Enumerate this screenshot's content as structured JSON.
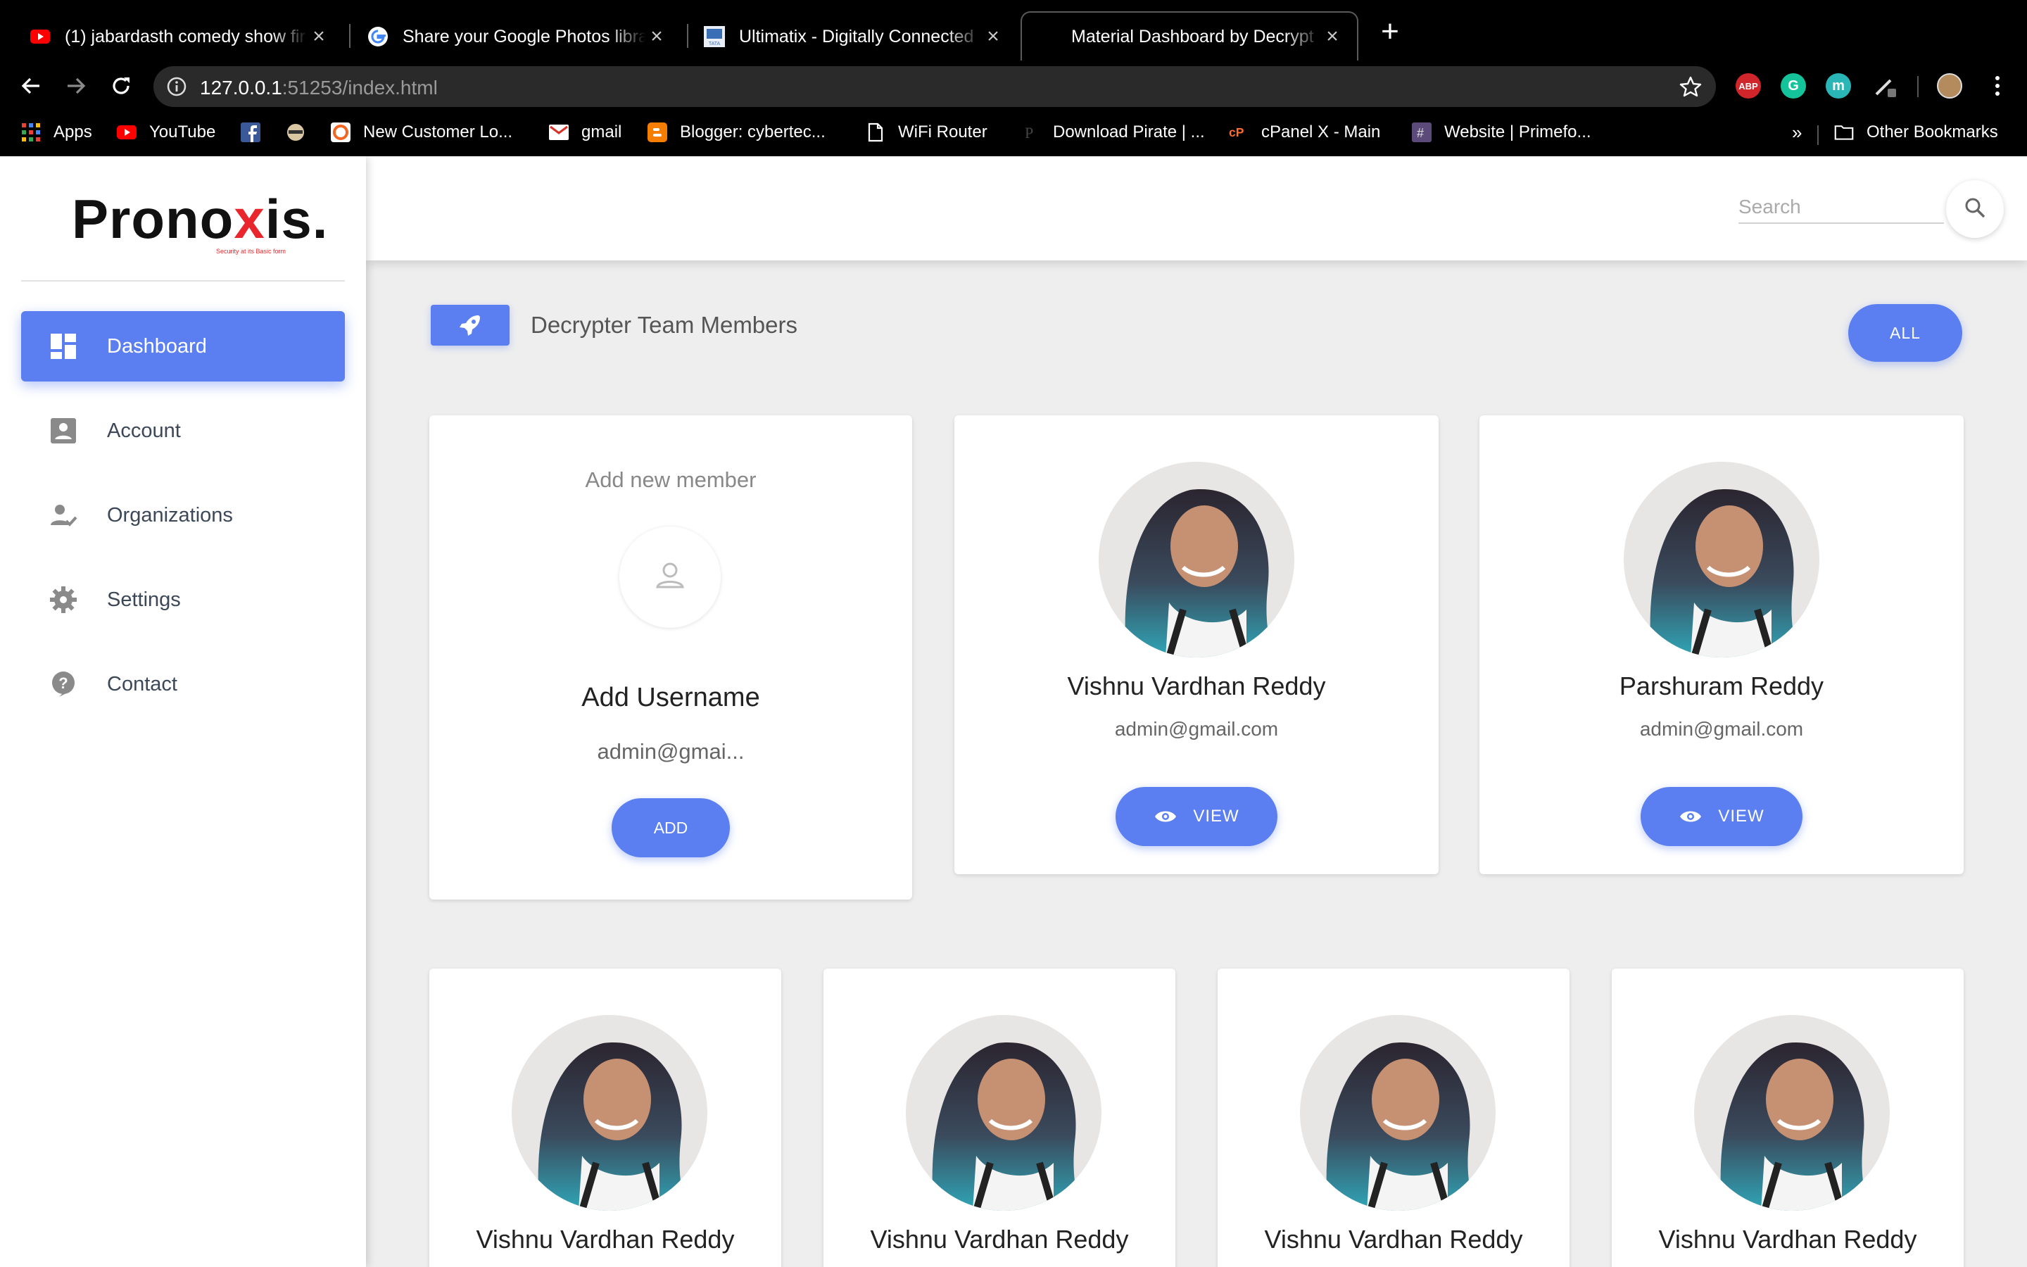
{
  "browser": {
    "tabs": [
      {
        "title": "(1) jabardasth comedy show fir",
        "favicon": "youtube-icon"
      },
      {
        "title": "Share your Google Photos libra",
        "favicon": "google-icon"
      },
      {
        "title": "Ultimatix - Digitally Connected",
        "favicon": "tata-icon"
      },
      {
        "title": "Material Dashboard by Decrypt",
        "favicon": "none",
        "active": true
      }
    ],
    "url_host": "127.0.0.1",
    "url_rest": ":51253/index.html",
    "extensions": [
      "ABP",
      "G",
      "m"
    ],
    "bookmarks": [
      {
        "label": "Apps",
        "icon": "apps-grid-icon"
      },
      {
        "label": "YouTube",
        "icon": "youtube-icon"
      },
      {
        "label": "",
        "icon": "facebook-icon"
      },
      {
        "label": "",
        "icon": "bookmark-icon"
      },
      {
        "label": "New Customer Lo...",
        "icon": "customer-icon"
      },
      {
        "label": "gmail",
        "icon": "gmail-icon"
      },
      {
        "label": "Blogger: cybertec...",
        "icon": "blogger-icon"
      },
      {
        "label": "WiFi Router",
        "icon": "page-icon"
      },
      {
        "label": "Download Pirate | ...",
        "icon": "pirate-icon"
      },
      {
        "label": "cPanel X - Main",
        "icon": "cpanel-icon"
      },
      {
        "label": "Website | Primefo...",
        "icon": "hash-icon"
      }
    ],
    "overflow_label": "»",
    "other_bookmarks": "Other Bookmarks"
  },
  "brand": {
    "logo_text_a": "Prono",
    "logo_text_x": "x",
    "logo_text_b": "is.",
    "tagline": "Security at its Basic form"
  },
  "sidebar": {
    "items": [
      {
        "label": "Dashboard",
        "icon": "dashboard-icon",
        "active": true
      },
      {
        "label": "Account",
        "icon": "account-icon"
      },
      {
        "label": "Organizations",
        "icon": "organizations-icon"
      },
      {
        "label": "Settings",
        "icon": "settings-icon"
      },
      {
        "label": "Contact",
        "icon": "contact-icon"
      }
    ]
  },
  "header": {
    "search_placeholder": "Search"
  },
  "main": {
    "section_title": "Decrypter Team Members",
    "filter_button": "ALL",
    "add_card": {
      "title": "Add new member",
      "username": "Add Username",
      "email": "admin@gmai...",
      "button": "ADD"
    },
    "members": [
      {
        "name": "Vishnu Vardhan Reddy",
        "email": "admin@gmail.com",
        "button": "VIEW"
      },
      {
        "name": "Parshuram Reddy",
        "email": "admin@gmail.com",
        "button": "VIEW"
      },
      {
        "name": "Vishnu Vardhan Reddy"
      },
      {
        "name": "Vishnu Vardhan Reddy"
      },
      {
        "name": "Vishnu Vardhan Reddy"
      },
      {
        "name": "Vishnu Vardhan Reddy"
      }
    ]
  },
  "colors": {
    "accent": "#5b7ff0",
    "logo_red": "#e8262b"
  }
}
